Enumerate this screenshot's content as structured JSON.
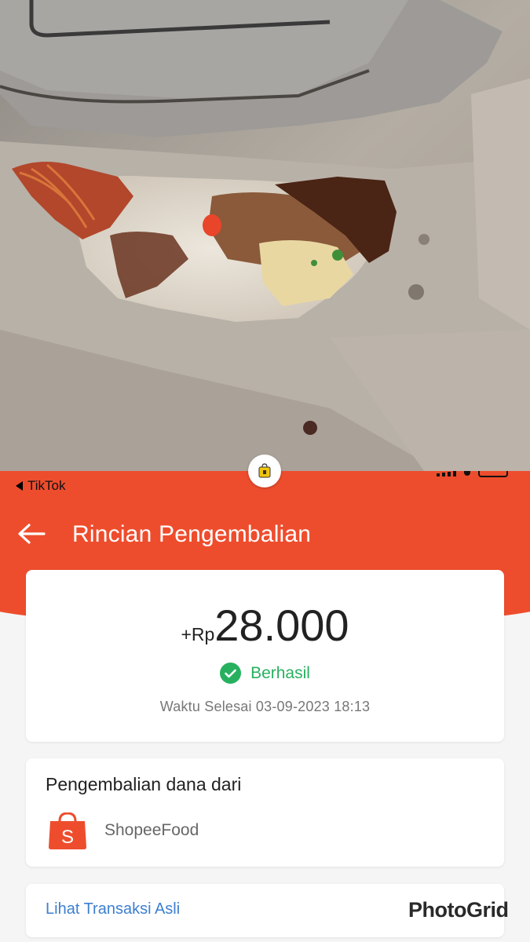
{
  "status_bar": {
    "back_app_label": "TikTok"
  },
  "header": {
    "title": "Rincian Pengembalian",
    "back_icon": "arrow-left-icon"
  },
  "refund": {
    "currency_prefix": "+Rp",
    "amount": "28.000",
    "status": "Berhasil",
    "completed_time": "Waktu Selesai 03-09-2023 18:13"
  },
  "source": {
    "title": "Pengembalian dana dari",
    "name": "ShopeeFood",
    "icon": "shopee-bag-icon"
  },
  "link": {
    "label": "Lihat Transaksi Asli"
  },
  "watermark": "PhotoGrid",
  "colors": {
    "brand": "#ee4d2d",
    "success": "#27b15f",
    "link": "#3d7fd0"
  }
}
